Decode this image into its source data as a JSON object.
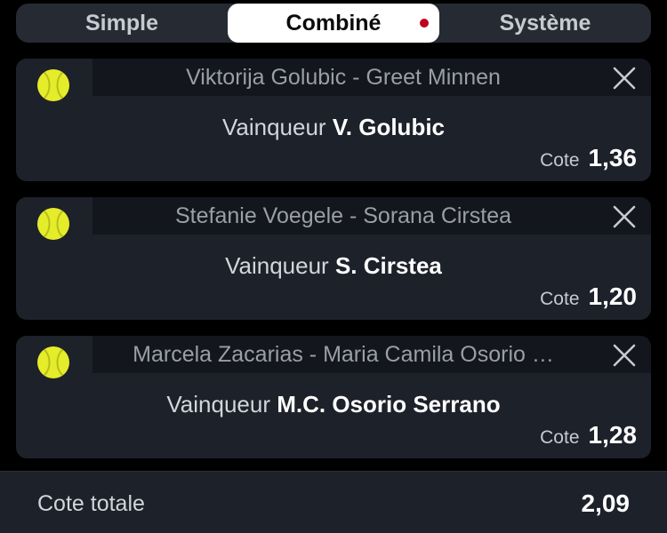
{
  "tabs": [
    {
      "label": "Simple"
    },
    {
      "label": "Combiné"
    },
    {
      "label": "Système"
    }
  ],
  "colors": {
    "background": "#000000",
    "card": "#1d212a",
    "card_header": "#13161c",
    "tab_bar": "#262a33",
    "active_tab": "#ffffff",
    "indicator": "#c0001a",
    "tennis_ball": "#e5ec2a"
  },
  "bets": [
    {
      "sport_icon": "tennis-ball-icon",
      "match": "Viktorija Golubic - Greet Minnen",
      "market": "Vainqueur",
      "selection": "V. Golubic",
      "odds_label": "Cote",
      "odds": "1,36"
    },
    {
      "sport_icon": "tennis-ball-icon",
      "match": "Stefanie Voegele - Sorana Cirstea",
      "market": "Vainqueur",
      "selection": "S. Cirstea",
      "odds_label": "Cote",
      "odds": "1,20"
    },
    {
      "sport_icon": "tennis-ball-icon",
      "match": "Marcela Zacarias - Maria Camila Osorio …",
      "market": "Vainqueur",
      "selection": "M.C. Osorio Serrano",
      "odds_label": "Cote",
      "odds": "1,28"
    }
  ],
  "footer": {
    "total_label": "Cote totale",
    "total_value": "2,09"
  }
}
